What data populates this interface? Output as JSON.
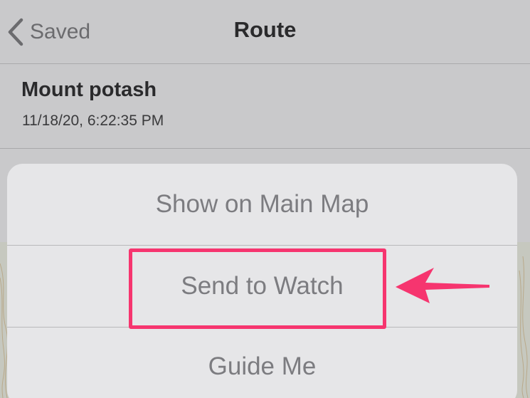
{
  "nav": {
    "back_label": "Saved",
    "title": "Route"
  },
  "route": {
    "name": "Mount potash",
    "date": "11/18/20, 6:22:35 PM"
  },
  "action_sheet": {
    "items": [
      {
        "label": "Show on Main Map"
      },
      {
        "label": "Send to Watch"
      },
      {
        "label": "Guide Me"
      }
    ]
  },
  "colors": {
    "highlight": "#f6356f",
    "accent_text": "#7c7c80"
  },
  "icons": {
    "back": "chevron-left-icon",
    "annotation": "arrow-left-icon"
  }
}
